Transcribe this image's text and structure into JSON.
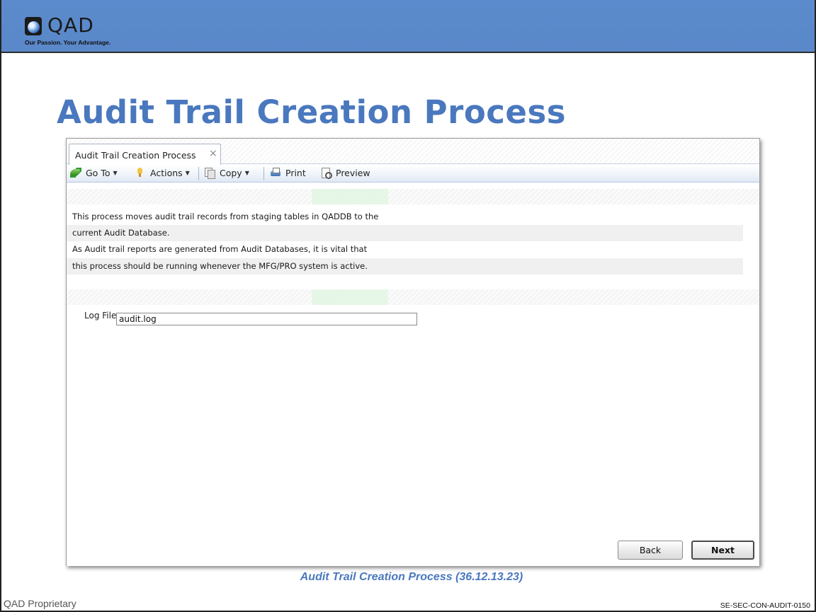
{
  "header": {
    "logo_text": "QAD",
    "tagline": "Our Passion. Your Advantage."
  },
  "slide": {
    "title": "Audit Trail Creation Process",
    "caption": "Audit Trail Creation Process (36.12.13.23)",
    "footer_left": "QAD Proprietary",
    "footer_right": "SE-SEC-CON-AUDIT-0150"
  },
  "window": {
    "tab_label": "Audit Trail Creation Process",
    "tab_close": "×",
    "toolbar": {
      "goto": "Go To",
      "actions": "Actions",
      "copy": "Copy",
      "print": "Print",
      "preview": "Preview"
    },
    "description": [
      "This process moves audit trail records from staging tables in QADDB to the",
      "current Audit Database.",
      "As Audit trail reports are generated from Audit Databases, it is vital that",
      "this process should be running whenever the MFG/PRO system is active."
    ],
    "log_file": {
      "label": "Log File:",
      "value": "audit.log"
    },
    "buttons": {
      "back": "Back",
      "next": "Next"
    }
  },
  "icons": [
    "go-to-icon",
    "actions-icon",
    "copy-icon",
    "print-icon",
    "preview-icon",
    "close-icon",
    "caret-down-icon"
  ],
  "colors": {
    "header_band": "#5b8bcc",
    "title": "#4a78be",
    "caption": "#4a78be"
  }
}
